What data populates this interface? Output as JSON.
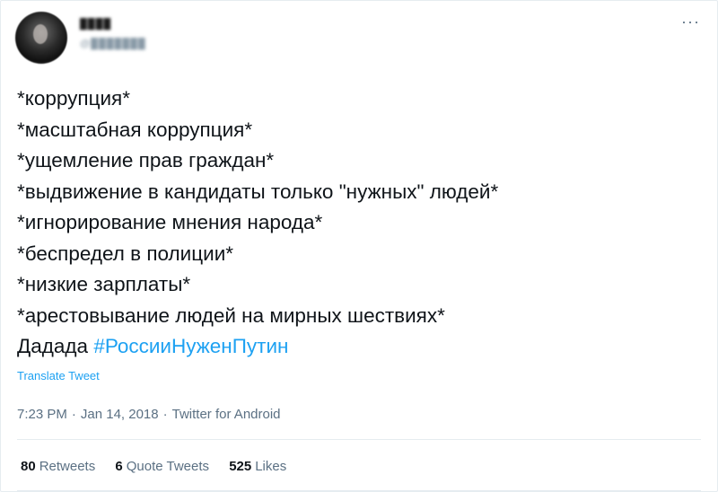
{
  "user": {
    "display_name": "████",
    "handle": "@███████"
  },
  "more_icon": "more-horizontal-icon",
  "tweet": {
    "lines": [
      "*коррупция*",
      "*масштабная коррупция*",
      "*ущемление прав граждан*",
      "*выдвижение в кандидаты только \"нужных\" людей*",
      "*игнорирование мнения народа*",
      "*беспредел в полиции*",
      "*низкие зарплаты*",
      "*арестовывание людей на мирных шествиях*"
    ],
    "last_line_text": "Дадада",
    "hashtag": "#РоссииНуженПутин"
  },
  "translate_label": "Translate Tweet",
  "meta": {
    "time": "7:23 PM",
    "date": "Jan 14, 2018",
    "source": "Twitter for Android",
    "separator": "·"
  },
  "stats": {
    "retweets_count": "80",
    "retweets_label": "Retweets",
    "quotes_count": "6",
    "quotes_label": "Quote Tweets",
    "likes_count": "525",
    "likes_label": "Likes"
  },
  "colors": {
    "accent": "#1da1f2",
    "text": "#0f1419",
    "secondary": "#5b7083",
    "border": "#e6ecf0"
  }
}
